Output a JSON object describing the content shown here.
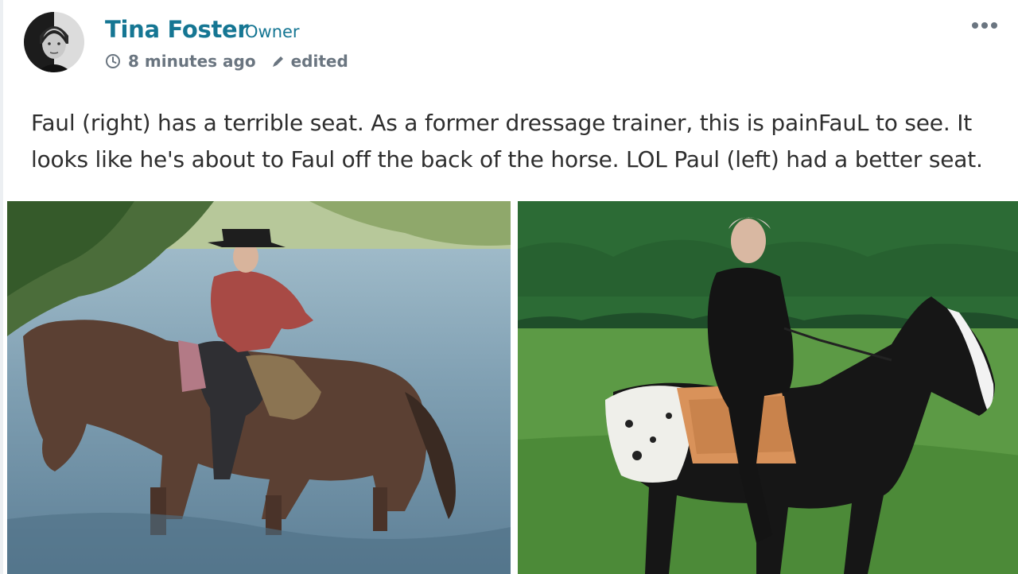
{
  "post": {
    "author": "Tina Foster",
    "role": "Owner",
    "timestamp": "8 minutes ago",
    "edited_label": "edited",
    "body_line1": "Faul (right) has a terrible seat. As a former dressage trainer, this is painFauL to see. It",
    "body_line2": "looks like he's about to Faul off the back of the horse. LOL Paul (left) had a better seat."
  },
  "icons": {
    "timestamp": "clock-icon",
    "edited": "pencil-icon",
    "menu": "more-dots-icon"
  },
  "colors": {
    "link": "#157693",
    "meta": "#6a7580",
    "text": "#2e2e2e"
  }
}
